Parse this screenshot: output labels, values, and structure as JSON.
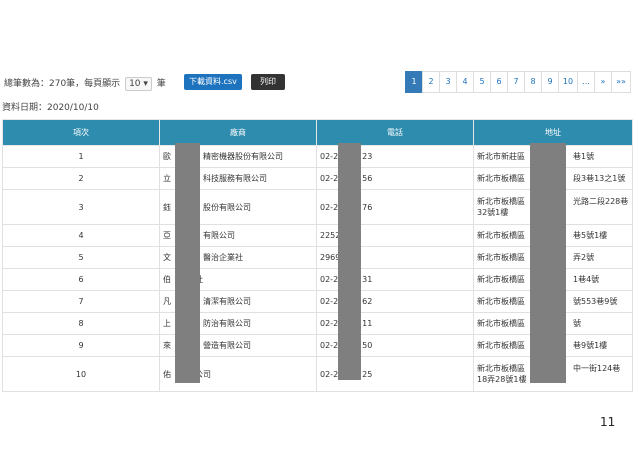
{
  "toolbar": {
    "summary_pre": "總筆數為：270筆，每頁顯示",
    "page_size": "10",
    "summary_post": "筆",
    "csv_label": "下載資料.csv",
    "print_label": "列印"
  },
  "pagination": [
    "1",
    "2",
    "3",
    "4",
    "5",
    "6",
    "7",
    "8",
    "9",
    "10",
    "…",
    "»",
    "»»"
  ],
  "update_date": "資料日期：2020/10/10",
  "table": {
    "headers": [
      "項次",
      "廠商",
      "電話",
      "地址"
    ],
    "rows": [
      {
        "no": "1",
        "company": "歐　　　　精密機器股份有限公司",
        "phone": "02-2　　　23",
        "address": "新北市新莊區　　　　　　巷1號"
      },
      {
        "no": "2",
        "company": "立　　　　科技服務有限公司",
        "phone": "02-2　　　56",
        "address": "新北市板橋區　　　　　　段3巷13之1號"
      },
      {
        "no": "3",
        "company": "鈺　　　　股份有限公司",
        "phone": "02-2　　　76",
        "address": "新北市板橋區　　　　　　光路二段228巷32號1樓"
      },
      {
        "no": "4",
        "company": "亞　　　　有限公司",
        "phone": "2252",
        "address": "新北市板橋區　　　　　　巷5號1樓"
      },
      {
        "no": "5",
        "company": "文　　　　醫治企業社",
        "phone": "2969",
        "address": "新北市板橋區　　　　　　弄2號"
      },
      {
        "no": "6",
        "company": "伯　　　社",
        "phone": "02-2　　　31",
        "address": "新北市板橋區　　　　　　1巷4號"
      },
      {
        "no": "7",
        "company": "凡　　　　清潔有限公司",
        "phone": "02-2　　　62",
        "address": "新北市板橋區　　　　　　號553巷9號"
      },
      {
        "no": "8",
        "company": "上　　　　防治有限公司",
        "phone": "02-2　　　11",
        "address": "新北市板橋區　　　　　　號"
      },
      {
        "no": "9",
        "company": "來　　　　營造有限公司",
        "phone": "02-2　　　50",
        "address": "新北市板橋區　　　　　　巷9號1樓"
      },
      {
        "no": "10",
        "company": "佑　　　公司",
        "phone": "02-2　　　25",
        "address": "新北市板橋區　　　　　　中一街124巷18弄28號1樓"
      }
    ]
  },
  "page_number": "11",
  "colors": {
    "header_bg": "#2e8cae",
    "csv_button": "#1e73be",
    "print_button": "#333333",
    "active_page": "#337ab7",
    "redaction": "#7f7f7f"
  }
}
